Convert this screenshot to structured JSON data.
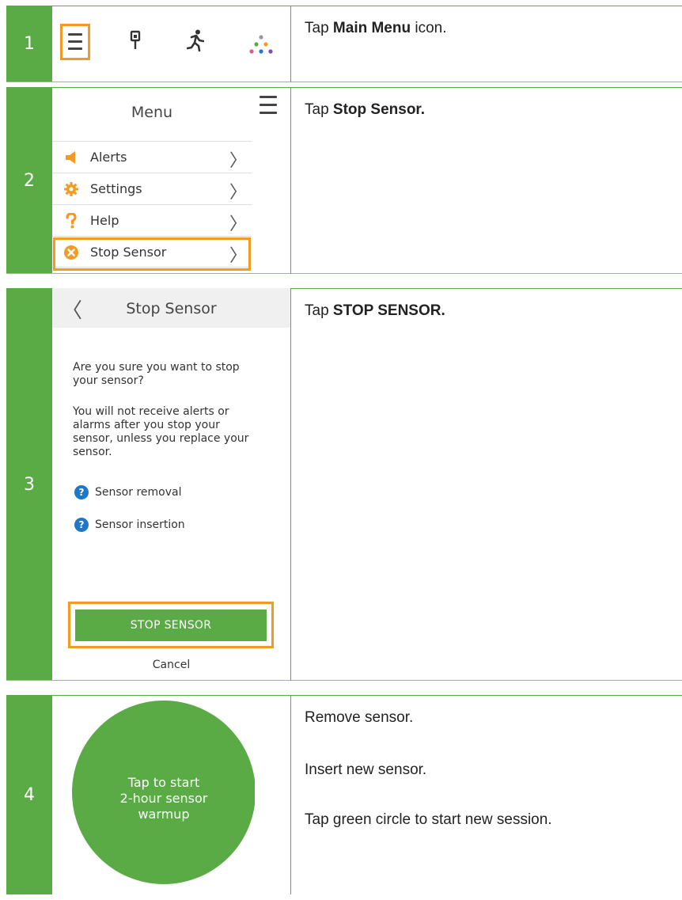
{
  "steps": [
    {
      "number": "1",
      "instruction_pre": "Tap ",
      "instruction_bold": "Main Menu",
      "instruction_post": " icon.",
      "toolbar_icons": [
        "main-menu-icon",
        "sensor-icon",
        "activity-icon",
        "dots-icon"
      ]
    },
    {
      "number": "2",
      "instruction_pre": "Tap ",
      "instruction_bold": "Stop Sensor.",
      "menu": {
        "title": "Menu",
        "items": [
          {
            "label": "Alerts",
            "icon": "speaker-icon"
          },
          {
            "label": "Settings",
            "icon": "gear-icon"
          },
          {
            "label": "Help",
            "icon": "question-icon"
          },
          {
            "label": "Stop Sensor",
            "icon": "stop-icon"
          }
        ],
        "chevron": "〉"
      }
    },
    {
      "number": "3",
      "instruction_pre": "Tap ",
      "instruction_bold": "STOP SENSOR.",
      "screen": {
        "back": "〈",
        "title": "Stop Sensor",
        "paragraph1": "Are you sure you want to stop your sensor?",
        "paragraph2": "You will not receive alerts or alarms after you stop your sensor, unless you replace your sensor.",
        "links": [
          "Sensor removal",
          "Sensor insertion"
        ],
        "button": "STOP SENSOR",
        "cancel": "Cancel"
      }
    },
    {
      "number": "4",
      "circle_text": [
        "Tap to start",
        "2-hour sensor",
        "warmup"
      ],
      "lines": [
        "Remove sensor.",
        "Insert new sensor.",
        "Tap green circle to start new session."
      ]
    }
  ],
  "colors": {
    "accent_green": "#5aab46",
    "highlight_orange": "#f29b24",
    "help_blue": "#1f77c9"
  }
}
